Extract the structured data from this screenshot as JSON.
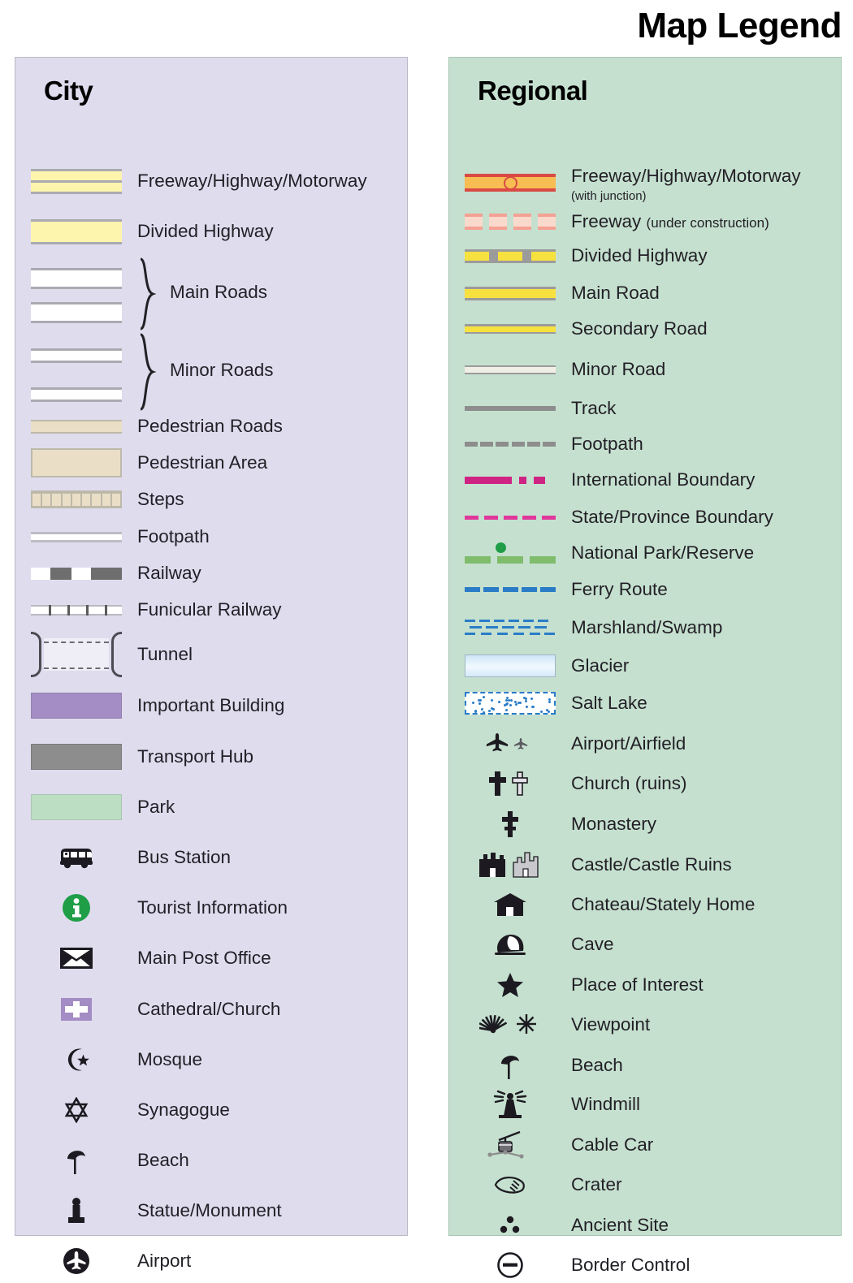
{
  "title": "Map Legend",
  "city": {
    "title": "City",
    "items": [
      {
        "label": "Freeway/Highway/Motorway",
        "icon": "city-freeway-swatch"
      },
      {
        "label": "Divided Highway",
        "icon": "city-divided-highway-swatch"
      },
      {
        "label": "Main Roads",
        "icon": "city-main-roads-swatch"
      },
      {
        "label": "Minor Roads",
        "icon": "city-minor-roads-swatch"
      },
      {
        "label": "Pedestrian Roads",
        "icon": "city-pedestrian-road-swatch"
      },
      {
        "label": "Pedestrian Area",
        "icon": "city-pedestrian-area-swatch"
      },
      {
        "label": "Steps",
        "icon": "city-steps-swatch"
      },
      {
        "label": "Footpath",
        "icon": "city-footpath-swatch"
      },
      {
        "label": "Railway",
        "icon": "city-railway-swatch"
      },
      {
        "label": "Funicular Railway",
        "icon": "city-funicular-swatch"
      },
      {
        "label": "Tunnel",
        "icon": "city-tunnel-swatch"
      },
      {
        "label": "Important Building",
        "icon": "city-important-building-swatch"
      },
      {
        "label": "Transport Hub",
        "icon": "city-transport-hub-swatch"
      },
      {
        "label": "Park",
        "icon": "city-park-swatch"
      },
      {
        "label": "Bus Station",
        "icon": "bus-icon"
      },
      {
        "label": "Tourist Information",
        "icon": "info-icon"
      },
      {
        "label": "Main Post Office",
        "icon": "envelope-icon"
      },
      {
        "label": "Cathedral/Church",
        "icon": "cross-on-purple-icon"
      },
      {
        "label": "Mosque",
        "icon": "crescent-star-icon"
      },
      {
        "label": "Synagogue",
        "icon": "star-of-david-icon"
      },
      {
        "label": "Beach",
        "icon": "beach-umbrella-icon"
      },
      {
        "label": "Statue/Monument",
        "icon": "statue-icon"
      },
      {
        "label": "Airport",
        "icon": "airplane-circle-icon"
      }
    ]
  },
  "regional": {
    "title": "Regional",
    "items": [
      {
        "label": "Freeway/Highway/Motorway",
        "sublabel": "(with junction)",
        "icon": "regional-freeway-swatch"
      },
      {
        "label": "Freeway",
        "sublabel": "(under construction)",
        "icon": "regional-freeway-construction-swatch"
      },
      {
        "label": "Divided Highway",
        "icon": "regional-divided-highway-swatch"
      },
      {
        "label": "Main Road",
        "icon": "regional-main-road-swatch"
      },
      {
        "label": "Secondary Road",
        "icon": "regional-secondary-road-swatch"
      },
      {
        "label": "Minor Road",
        "icon": "regional-minor-road-swatch"
      },
      {
        "label": "Track",
        "icon": "regional-track-swatch"
      },
      {
        "label": "Footpath",
        "icon": "regional-footpath-swatch"
      },
      {
        "label": "International Boundary",
        "icon": "international-boundary-swatch"
      },
      {
        "label": "State/Province Boundary",
        "icon": "state-boundary-swatch"
      },
      {
        "label": "National Park/Reserve",
        "icon": "national-park-swatch"
      },
      {
        "label": "Ferry Route",
        "icon": "ferry-route-swatch"
      },
      {
        "label": "Marshland/Swamp",
        "icon": "marshland-swatch"
      },
      {
        "label": "Glacier",
        "icon": "glacier-swatch"
      },
      {
        "label": "Salt Lake",
        "icon": "salt-lake-swatch"
      },
      {
        "label": "Airport/Airfield",
        "icon": "airplane-pair-icon"
      },
      {
        "label": "Church (ruins)",
        "icon": "cross-pair-icon"
      },
      {
        "label": "Monastery",
        "icon": "orthodox-cross-icon"
      },
      {
        "label": "Castle/Castle Ruins",
        "icon": "castle-pair-icon"
      },
      {
        "label": "Chateau/Stately Home",
        "icon": "chateau-icon"
      },
      {
        "label": "Cave",
        "icon": "cave-icon"
      },
      {
        "label": "Place of Interest",
        "icon": "star-icon"
      },
      {
        "label": "Viewpoint",
        "icon": "viewpoint-pair-icon"
      },
      {
        "label": "Beach",
        "icon": "beach-umbrella-icon"
      },
      {
        "label": "Windmill",
        "icon": "windmill-icon"
      },
      {
        "label": "Cable Car",
        "icon": "cable-car-icon"
      },
      {
        "label": "Crater",
        "icon": "crater-icon"
      },
      {
        "label": "Ancient Site",
        "icon": "ancient-site-icon"
      },
      {
        "label": "Border Control",
        "icon": "border-control-icon"
      }
    ]
  },
  "colors": {
    "city_panel_bg": "#dfdcee",
    "regional_panel_bg": "#c5e0cf",
    "highway_yellow": "#fdf4ae",
    "road_yellow": "#f7e13f",
    "freeway_red": "#d94a45",
    "freeway_orange": "#f7bd52",
    "construction_pink": "#f4a193",
    "pedestrian_tan": "#eadfc6",
    "important_building_purple": "#a48cc4",
    "transport_hub_gray": "#8d8d8d",
    "park_green": "#bcdec3",
    "boundary_magenta": "#cf2384",
    "state_boundary_pink": "#e0379b",
    "national_park_green": "#7fbd6d",
    "ferry_blue": "#2a7cc7",
    "tourist_info_green": "#1f9e47"
  }
}
